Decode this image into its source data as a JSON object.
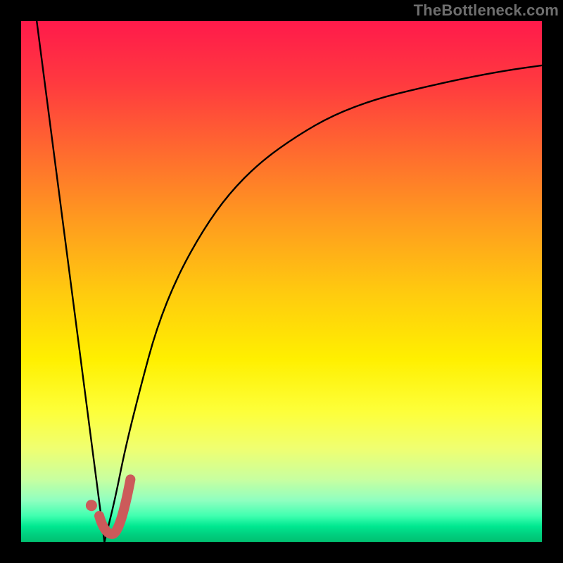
{
  "watermark": "TheBottleneck.com",
  "colors": {
    "curve_stroke": "#000000",
    "marker_stroke": "#cc5a5a",
    "marker_fill": "#cc5a5a"
  },
  "chart_data": {
    "type": "line",
    "title": "",
    "xlabel": "",
    "ylabel": "",
    "xlim": [
      0,
      100
    ],
    "ylim": [
      0,
      100
    ],
    "grid": false,
    "legend": false,
    "series": [
      {
        "name": "bottleneck-left",
        "x": [
          3,
          16
        ],
        "y": [
          100,
          0
        ]
      },
      {
        "name": "bottleneck-right",
        "x": [
          16,
          18,
          20,
          23,
          26,
          30,
          35,
          40,
          46,
          53,
          60,
          68,
          76,
          85,
          93,
          100
        ],
        "y": [
          0,
          8,
          18,
          30,
          41,
          51,
          60,
          67,
          73,
          78,
          82,
          85,
          87,
          89,
          90.5,
          91.5
        ]
      }
    ],
    "annotations": [
      {
        "name": "marker-j-shape",
        "type": "path",
        "points": [
          {
            "x": 15,
            "y": 5
          },
          {
            "x": 16,
            "y": 1.5
          },
          {
            "x": 19,
            "y": 1.5
          },
          {
            "x": 21,
            "y": 12
          }
        ]
      },
      {
        "name": "marker-dot",
        "type": "dot",
        "x": 13.5,
        "y": 7
      }
    ]
  }
}
